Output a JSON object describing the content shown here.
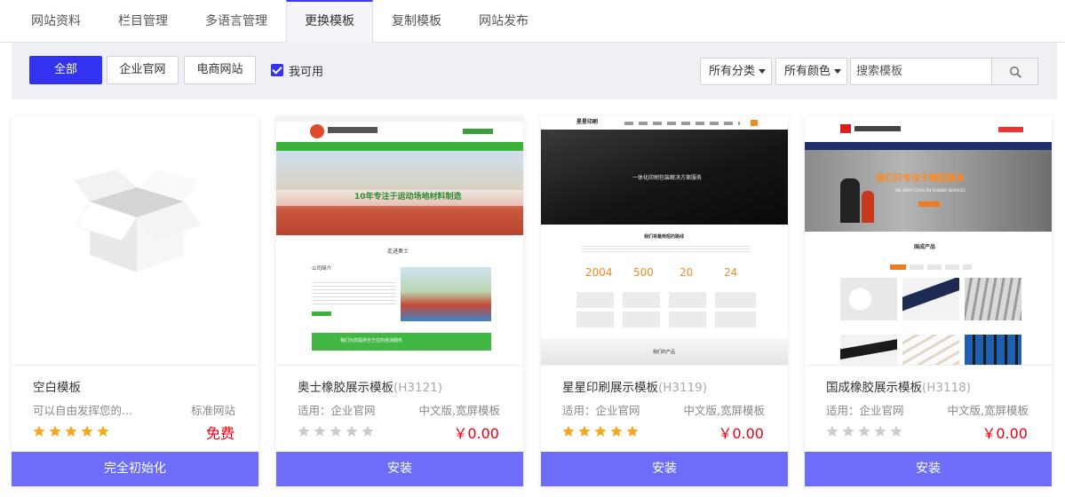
{
  "tabs": [
    {
      "label": "网站资料",
      "active": false
    },
    {
      "label": "栏目管理",
      "active": false
    },
    {
      "label": "多语言管理",
      "active": false
    },
    {
      "label": "更换模板",
      "active": true
    },
    {
      "label": "复制模板",
      "active": false
    },
    {
      "label": "网站发布",
      "active": false
    }
  ],
  "filters": {
    "all_label": "全部",
    "enterprise_label": "企业官网",
    "ecommerce_label": "电商网站",
    "available_label": "我可用",
    "available_checked": true,
    "category_label": "所有分类",
    "color_label": "所有颜色",
    "search_placeholder": "搜索模板",
    "accent_color": "#3232f0"
  },
  "cards": [
    {
      "title": "空白模板",
      "code": "",
      "meta_left": "可以自由发挥您的...",
      "meta_right": "标准网站",
      "price": "免费",
      "stars": 5,
      "button": "完全初始化"
    },
    {
      "title": "奥士橡胶展示模板",
      "code": "(H3121)",
      "meta_left": "适用：企业官网",
      "meta_right": "中文版,宽屏模板",
      "price": "￥0.00",
      "stars": 0,
      "button": "安装",
      "preview": {
        "banner": "10年专注于运动场地材料制造",
        "section": "走进奥士",
        "about": "公司简介",
        "footer_strip": "我们为您提供全方位的咨询服务"
      }
    },
    {
      "title": "星星印刷展示模板",
      "code": "(H3119)",
      "meta_left": "适用：企业官网",
      "meta_right": "中文版,宽屏模板",
      "price": "￥0.00",
      "stars": 5,
      "button": "安装",
      "preview": {
        "logo": "星星印刷",
        "banner": "一体化印刷包装解决方案服务",
        "section": "我们将最简短的路线",
        "stats": [
          "2004",
          "500",
          "20",
          "24"
        ],
        "bottom": "我们的产品"
      }
    },
    {
      "title": "国成橡胶展示模板",
      "code": "(H3118)",
      "meta_left": "适用：企业官网",
      "meta_right": "中文版,宽屏模板",
      "price": "￥0.00",
      "stars": 0,
      "button": "安装",
      "preview": {
        "banner": "我们只专注于橡胶服务",
        "banner_sub": "WE ONLY FOCUS ON RUBBER SERVICES",
        "section": "国成产品"
      }
    }
  ],
  "colors": {
    "card_button": "#6d6df9",
    "price": "#e60012",
    "star_on": "#f5a623",
    "star_off": "#cccccc"
  }
}
